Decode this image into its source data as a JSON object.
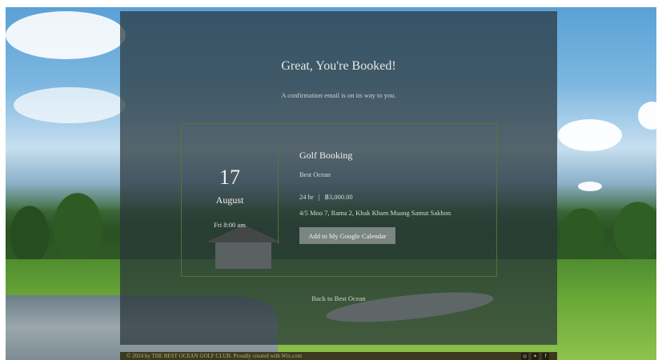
{
  "confirmation": {
    "headline": "Great, You're Booked!",
    "subline": "A confirmation email is on its way to you."
  },
  "booking": {
    "day": "17",
    "month": "August",
    "time": "Fri 8:00 am",
    "title": "Golf Booking",
    "provider": "Best Ocean",
    "duration": "24 hr",
    "separator": "|",
    "price": "฿3,000.00",
    "address": "4/5 Moo 7, Rama 2, Khak Kham Muang Samut Sakhon",
    "calendar_button": "Add to My Google Calendar"
  },
  "back_link": "Back to Best Ocean",
  "footer": {
    "text": "© 2024 by THE BEST OCEAN GOLF CLUB. Proudly created with Wix.com",
    "social_icons": [
      "instagram-icon",
      "twitter-icon",
      "facebook-icon"
    ]
  },
  "colors": {
    "overlay": "#28343A",
    "frame_border": "#587634",
    "footer_bg": "#3B3A1F"
  }
}
